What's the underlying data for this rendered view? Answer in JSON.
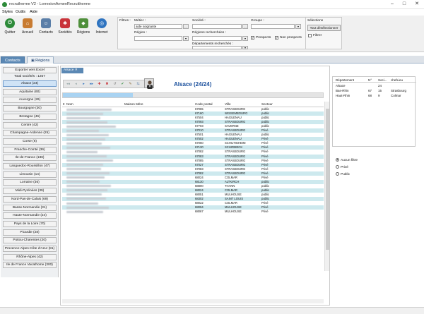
{
  "window": {
    "title": "recrutherme V2 - LorrexionArmenRecruitherme",
    "minimize": "–",
    "maximize": "□",
    "close": "✕"
  },
  "menu": [
    "Styles",
    "Outils",
    "Aide"
  ],
  "toolbar": [
    {
      "label": "Quitter",
      "icon": "power-icon",
      "color": "#2e8b3a"
    },
    {
      "label": "Accueil",
      "icon": "home-icon",
      "color": "#c87b31"
    },
    {
      "label": "Contacts",
      "icon": "contacts-icon",
      "color": "#5a7ea8"
    },
    {
      "label": "Sociétés",
      "icon": "companies-icon",
      "color": "#c9333a"
    },
    {
      "label": "Régions",
      "icon": "regions-icon",
      "color": "#4f8f3b"
    },
    {
      "label": "Internet",
      "icon": "globe-icon",
      "color": "#2f74c0"
    }
  ],
  "filters": {
    "title": "Filtres :",
    "metier_label": "Métier :",
    "metier_value": "aide soignante",
    "region_label": "Région :",
    "societe_label": "Société :",
    "regions_recherchees_label": "Régions recherchées :",
    "departements_label": "Départements recherchés :",
    "groupe_label": "Groupe :",
    "prospects_label": "Prospects",
    "non_prospects_label": "Non prospects",
    "dropdown_glyph": "▾",
    "dots_glyph": "…",
    "check_glyph": "✓"
  },
  "selections": {
    "title": "Sélections",
    "button": "Tout désélectionner",
    "filtrer_label": "Filtrer"
  },
  "tabs": [
    {
      "label": "Contacts"
    },
    {
      "label": "Régions"
    }
  ],
  "sidebar": {
    "export_label": "Exporter vers Excel",
    "total_label": "Total sociétés : 1257",
    "regions": [
      "Alsace (24)",
      "Aquitaine (60)",
      "Auvergne (26)",
      "Bourgogne (30)",
      "Bretagne (46)",
      "Centre (42)",
      "Champagne-Ardenne (25)",
      "Corse (6)",
      "Franche-Comté (36)",
      "Ile-de-France (186)",
      "Languedoc-Roussillon (47)",
      "Limousin (14)",
      "Lorraine (36)",
      "Midi-Pyrénées (39)",
      "Nord-Pas-de-Calais (69)",
      "Basse-Normandie (31)",
      "Haute-Normandie (24)",
      "Pays de la Loire (70)",
      "Picardie (28)",
      "Poitou-Charentes (20)",
      "Provence-Alpes-Côte d'Azur (81)",
      "Rhône-Alpes (42)",
      "Ile de France Vacathome (300)"
    ]
  },
  "center": {
    "subtab": "Alsace",
    "region_title": "Alsace (24/24)",
    "nav_buttons": [
      "◂◂",
      "◂",
      "▸",
      "▸▸",
      "✚",
      "✖",
      "↺",
      "✔",
      "✎",
      "⇆"
    ],
    "progress_fraction": 0.27,
    "headers": [
      "Nom",
      "Maison Mère",
      "Code postal",
      "Ville",
      "Secteur"
    ],
    "rows": [
      [
        "67065",
        "STRASBOURG",
        "public"
      ],
      [
        "67160",
        "WISSEMBOURG",
        "public"
      ],
      [
        "67504",
        "HAGUENAU",
        "public"
      ],
      [
        "67093",
        "STRASBOURG",
        "public"
      ],
      [
        "67703",
        "SAVERNE",
        "public"
      ],
      [
        "67010",
        "STRASBOURG",
        "Privé"
      ],
      [
        "67501",
        "HAGUENAU",
        "public"
      ],
      [
        "67502",
        "HAGUENAU",
        "Privé"
      ],
      [
        "67060",
        "SCHILTIGHEIM",
        "Privé"
      ],
      [
        "67130",
        "SCHIRMECK",
        "Privé"
      ],
      [
        "67082",
        "STRASBOURG",
        "Privé"
      ],
      [
        "67083",
        "STRASBOURG",
        "Privé"
      ],
      [
        "67085",
        "STRASBOURG",
        "Privé"
      ],
      [
        "67027",
        "STRASBOURG",
        "Privé"
      ],
      [
        "67083",
        "STRASBOURG",
        "Privé"
      ],
      [
        "67082",
        "STRASBOURG",
        "Privé"
      ],
      [
        "68024",
        "COLMAR",
        "Privé"
      ],
      [
        "68130",
        "ALTKIRCH",
        "public"
      ],
      [
        "68800",
        "THANN",
        "public"
      ],
      [
        "68024",
        "COLMAR",
        "public"
      ],
      [
        "68051",
        "MULHOUSE",
        "public"
      ],
      [
        "68302",
        "SAINT LOUIS",
        "public"
      ],
      [
        "68022",
        "COLMAR",
        "Privé"
      ],
      [
        "68094",
        "MULHOUSE",
        "Privé"
      ],
      [
        "68067",
        "MULHOUSE",
        "Privé"
      ]
    ]
  },
  "right_panel": {
    "headers": [
      "Département",
      "N°",
      "Soci...",
      "chefLieu"
    ],
    "rows": [
      [
        "Alsace",
        "",
        "24",
        ""
      ],
      [
        "Bas-Rhin",
        "67",
        "15",
        "Strasbourg"
      ],
      [
        "Haut-Rhin",
        "68",
        "9",
        "Colmar"
      ]
    ]
  },
  "radios": [
    "Aucun filtre",
    "Privé",
    "Public"
  ]
}
